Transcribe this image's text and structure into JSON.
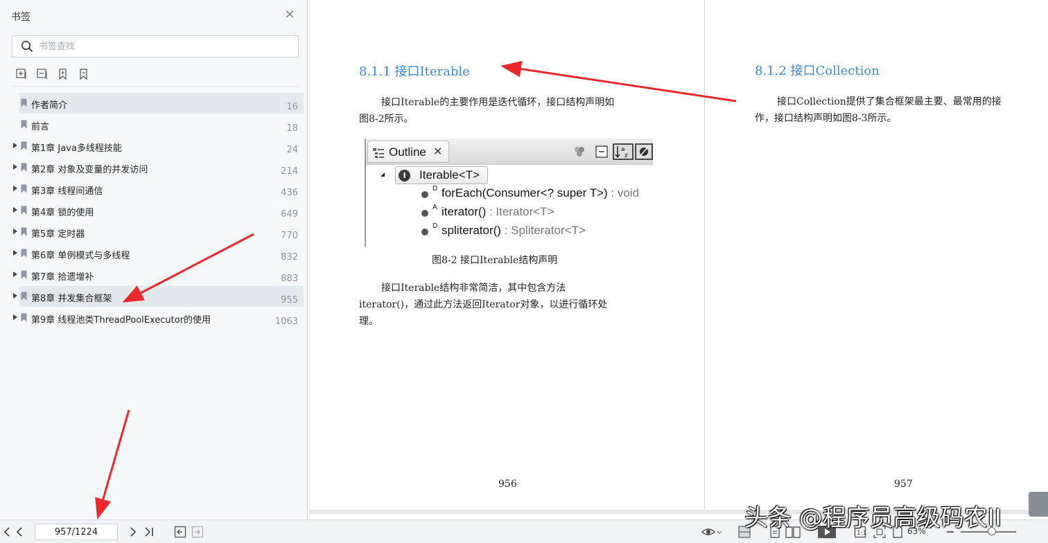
{
  "sidebar": {
    "title": "书签",
    "search_placeholder": "书签查找",
    "bookmarks": [
      {
        "label": "作者简介",
        "page": "16",
        "expandable": false,
        "selected": true
      },
      {
        "label": "前言",
        "page": "18",
        "expandable": false,
        "selected": false
      },
      {
        "label": "第1章 Java多线程技能",
        "page": "24",
        "expandable": true,
        "selected": false
      },
      {
        "label": "第2章 对象及变量的并发访问",
        "page": "214",
        "expandable": true,
        "selected": false
      },
      {
        "label": "第3章 线程间通信",
        "page": "436",
        "expandable": true,
        "selected": false
      },
      {
        "label": "第4章 锁的使用",
        "page": "649",
        "expandable": true,
        "selected": false
      },
      {
        "label": "第5章 定时器",
        "page": "770",
        "expandable": true,
        "selected": false
      },
      {
        "label": "第6章 单例模式与多线程",
        "page": "832",
        "expandable": true,
        "selected": false
      },
      {
        "label": "第7章 拾遗增补",
        "page": "883",
        "expandable": true,
        "selected": false
      },
      {
        "label": "第8章 并发集合框架",
        "page": "955",
        "expandable": true,
        "selected": true
      },
      {
        "label": "第9章 线程池类ThreadPoolExecutor的使用",
        "page": "1063",
        "expandable": true,
        "selected": false
      }
    ]
  },
  "doc": {
    "left_page": {
      "heading": "8.1.1   接口Iterable",
      "para1_line1": "接口Iterable的主要作用是迭代循环，接口结构声明如",
      "para1_line2": "图8-2所示。",
      "figure": {
        "tab_title": "Outline",
        "root": "Iterable<T>",
        "rows": [
          {
            "mod": "D",
            "name": "forEach(Consumer<? super T>)",
            "type": " : void"
          },
          {
            "mod": "A",
            "name": "iterator()",
            "type": " : Iterator<T>"
          },
          {
            "mod": "D",
            "name": "spliterator()",
            "type": " : Spliterator<T>"
          }
        ]
      },
      "caption": "图8-2   接口Iterable结构声明",
      "para2_line1": "接口Iterable结构非常简洁，其中包含方法",
      "para2_line2": "iterator()，通过此方法返回Iterator对象，以进行循环处",
      "para2_line3": "理。",
      "page_number": "956"
    },
    "right_page": {
      "heading": "8.1.2   接口Collection",
      "para1_line1": "接口Collection提供了集合框架最主要、最常用的接",
      "para1_line2": "作，接口结构声明如图8-3所示。",
      "page_number": "957"
    }
  },
  "bottom": {
    "page_indicator": "957/1224",
    "zoom": "63%"
  },
  "watermark": "头条 @程序员高级码农II",
  "colors": {
    "heading": "#3a8ad0",
    "arrow": "#e8282b",
    "sidebar_bg": "#f5f7f9",
    "selected_bg": "#e4e7eb"
  }
}
